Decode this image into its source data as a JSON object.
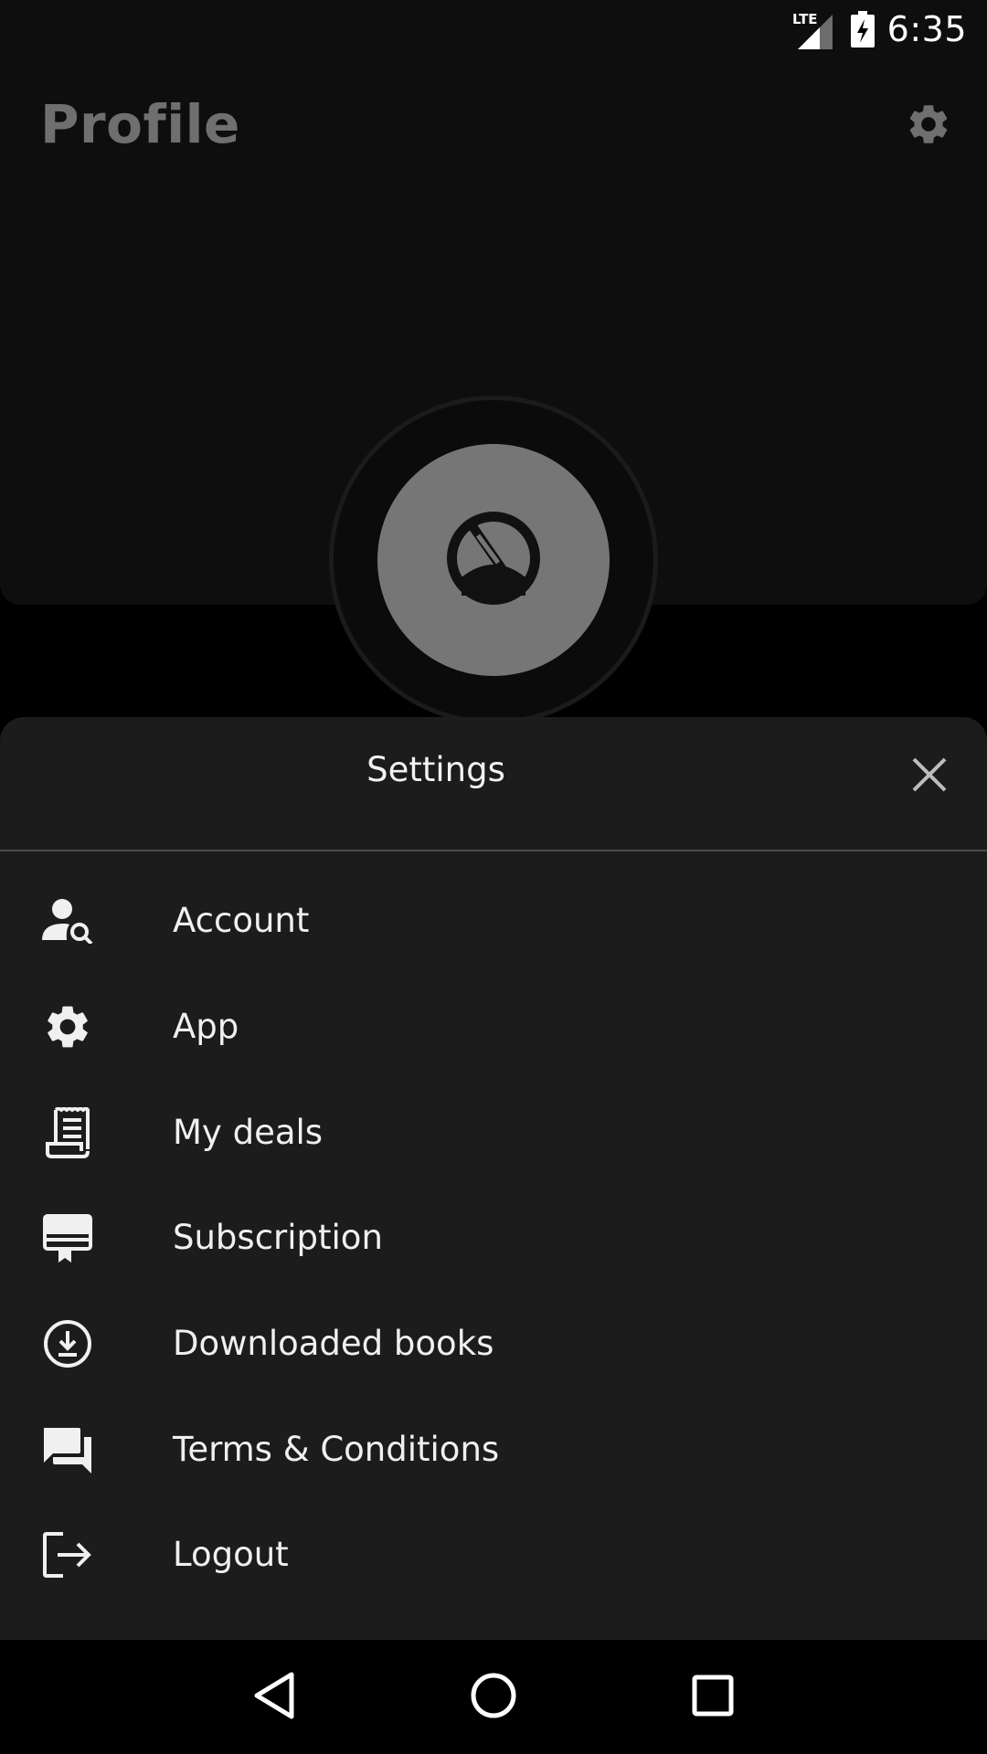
{
  "status_bar": {
    "time": "6:35",
    "network": "LTE",
    "icons": [
      "lte-signal-icon",
      "battery-charging-icon"
    ]
  },
  "profile": {
    "title": "Profile",
    "settings_icon": "gear-icon",
    "avatar_icon": "no-signal-gauge-icon"
  },
  "settings_sheet": {
    "title": "Settings",
    "close_icon": "close-icon",
    "items": [
      {
        "label": "Account",
        "icon": "account-search-icon"
      },
      {
        "label": "App",
        "icon": "gear-icon"
      },
      {
        "label": "My deals",
        "icon": "receipt-icon"
      },
      {
        "label": "Subscription",
        "icon": "card-membership-icon"
      },
      {
        "label": "Downloaded books",
        "icon": "download-circle-icon"
      },
      {
        "label": "Terms & Conditions",
        "icon": "forum-icon"
      },
      {
        "label": "Logout",
        "icon": "logout-icon"
      }
    ]
  },
  "nav_bar": {
    "icons": [
      "back-icon",
      "home-icon",
      "recents-icon"
    ]
  },
  "colors": {
    "sheet_background": "#1c1c1d",
    "background": "#000000",
    "text": "#f0f0f0",
    "dim_text": "#6f6f6f",
    "avatar": "#767676"
  }
}
